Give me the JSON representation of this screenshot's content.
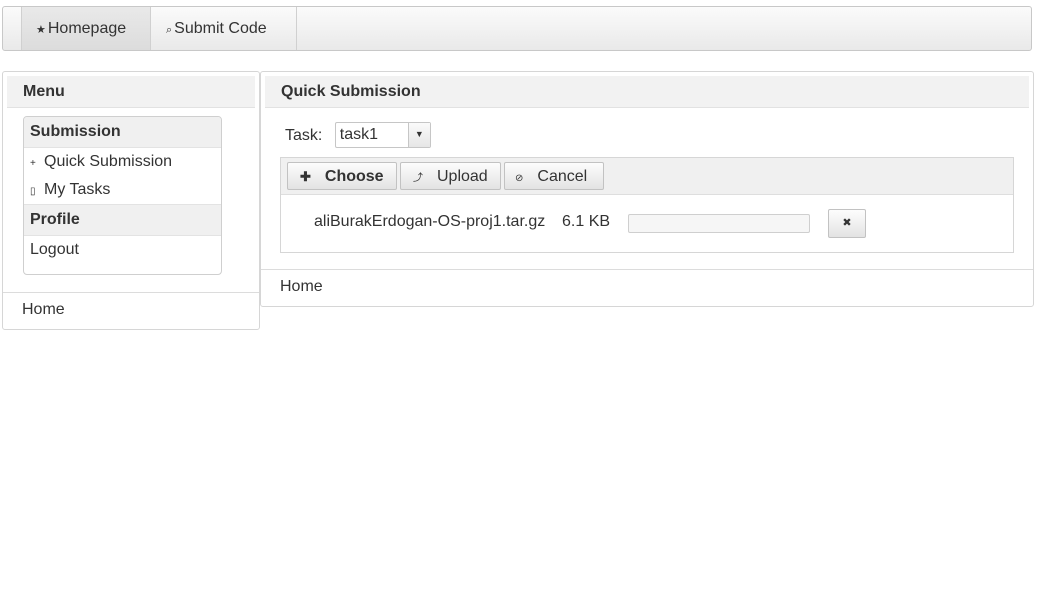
{
  "topnav": {
    "tabs": [
      {
        "label": "Homepage",
        "icon": "star-icon",
        "glyph": "★"
      },
      {
        "label": "Submit Code",
        "icon": "search-icon",
        "glyph": "⌕"
      }
    ]
  },
  "menu": {
    "title": "Menu",
    "sections": [
      {
        "label": "Submission",
        "items": [
          {
            "label": "Quick Submission",
            "icon": "plus-icon",
            "glyph": "+"
          },
          {
            "label": "My Tasks",
            "icon": "document-icon",
            "glyph": "▯"
          }
        ]
      },
      {
        "label": "Profile",
        "items": [
          {
            "label": "Logout"
          }
        ]
      }
    ],
    "footer": "Home"
  },
  "main": {
    "title": "Quick Submission",
    "task_label": "Task:",
    "task_value": "task1",
    "buttons": {
      "choose": "Choose",
      "upload": "Upload",
      "cancel": "Cancel"
    },
    "file": {
      "name": "aliBurakErdogan-OS-proj1.tar.gz",
      "size": "6.1 KB",
      "progress": 0
    },
    "footer": "Home"
  }
}
